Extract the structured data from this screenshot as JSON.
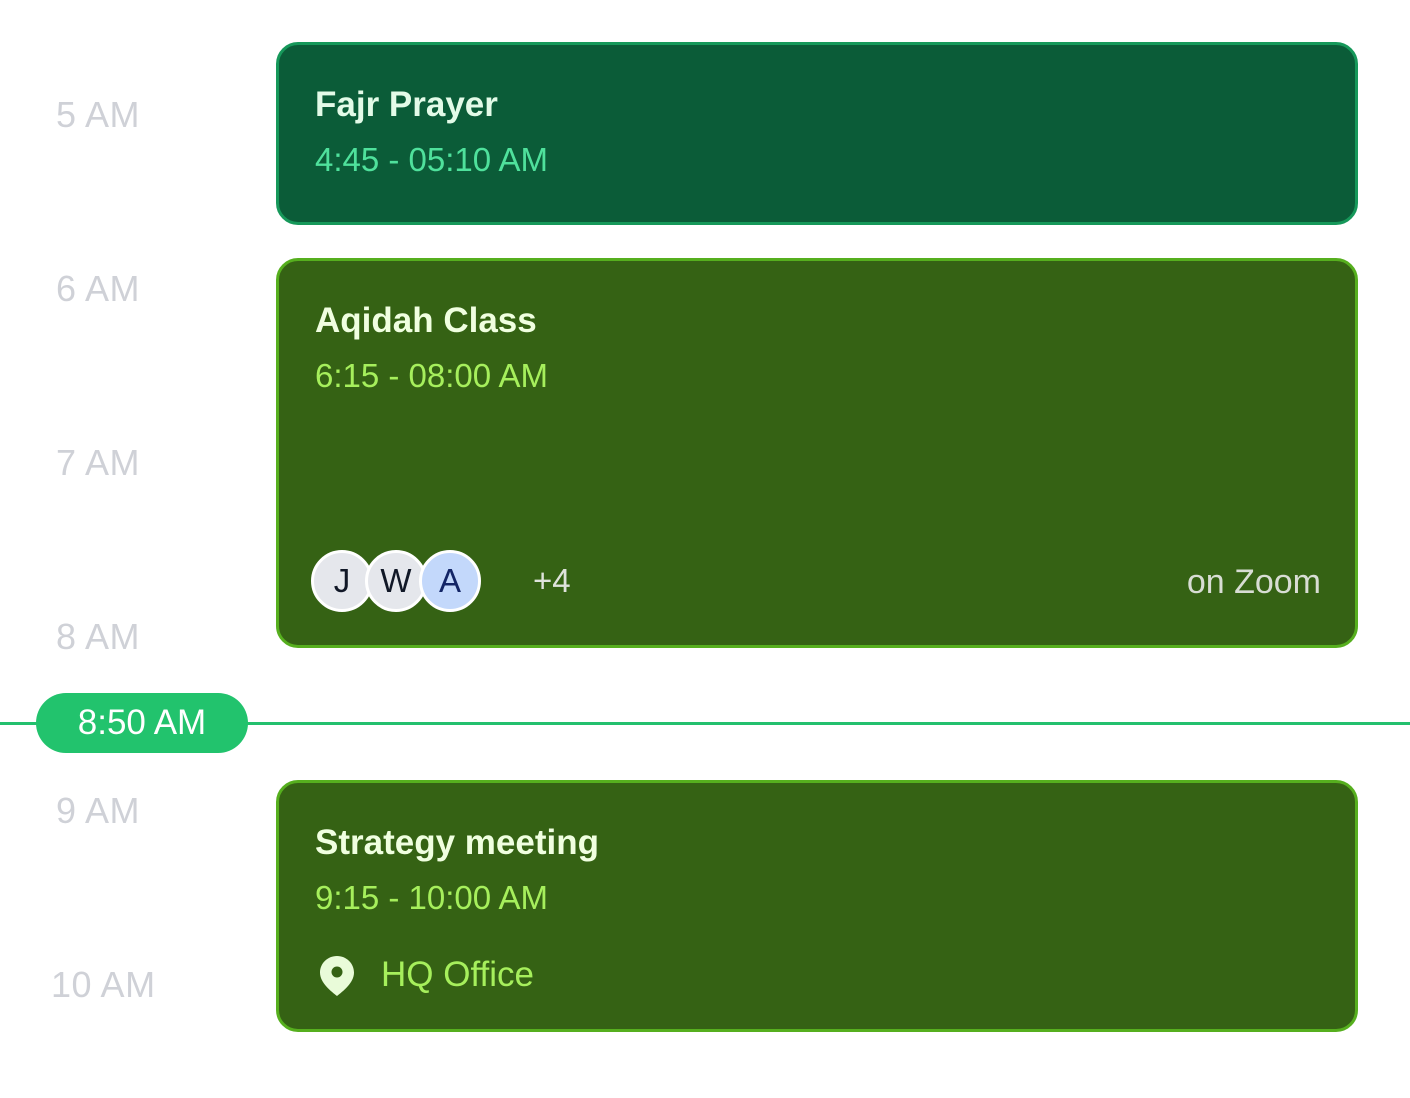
{
  "timeline": {
    "hours": [
      "5 AM",
      "6 AM",
      "7 AM",
      "8 AM",
      "9 AM",
      "10 AM"
    ]
  },
  "current_time": {
    "label": "8:50 AM"
  },
  "events": [
    {
      "title": "Fajr Prayer",
      "time": "4:45 - 05:10 AM"
    },
    {
      "title": "Aqidah Class",
      "time": "6:15 - 08:00 AM",
      "attendees": [
        "J",
        "W",
        "A"
      ],
      "more": "+4",
      "location": "on Zoom"
    },
    {
      "title": "Strategy meeting",
      "time": "9:15 - 10:00 AM",
      "location_icon": "map-pin-icon",
      "location": "HQ Office"
    }
  ]
}
